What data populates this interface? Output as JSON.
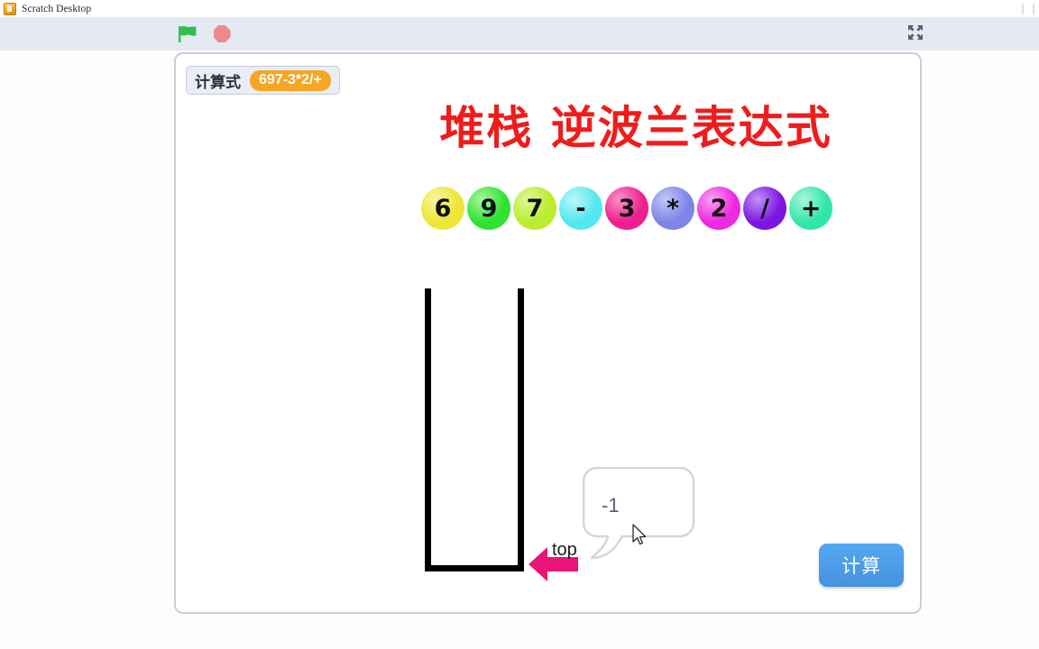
{
  "window": {
    "title": "Scratch Desktop",
    "app_icon": "scratch-app-icon",
    "minimize_icon": "minimize-icon"
  },
  "toolbar": {
    "green_flag_icon": "green-flag-icon",
    "stop_icon": "stop-sign-icon",
    "fullscreen_icon": "exit-fullscreen-icon"
  },
  "stage": {
    "monitor": {
      "label": "计算式",
      "value": "697-3*2/+"
    },
    "title": "堆栈  逆波兰表达式",
    "title_color": "#f01c1c",
    "tokens": [
      {
        "text": "6",
        "color": "#ede637",
        "highlight": "#f7f59e"
      },
      {
        "text": "9",
        "color": "#2fe22f",
        "highlight": "#a9f7a1"
      },
      {
        "text": "7",
        "color": "#b9ed2e",
        "highlight": "#e0f79b"
      },
      {
        "text": "-",
        "color": "#52e8ef",
        "highlight": "#bdf7fa"
      },
      {
        "text": "3",
        "color": "#ee1f8f",
        "highlight": "#fa95c8"
      },
      {
        "text": "*",
        "color": "#7d85e8",
        "highlight": "#c3c7f6"
      },
      {
        "text": "2",
        "color": "#ef29e0",
        "highlight": "#f9a2f2"
      },
      {
        "text": "/",
        "color": "#7b16e0",
        "highlight": "#c193f5"
      },
      {
        "text": "+",
        "color": "#31e7a8",
        "highlight": "#a8f6dc"
      }
    ],
    "stack": {
      "top_label": "top",
      "arrow_color": "#ea1478",
      "border_color": "#000000",
      "contents": []
    },
    "speech_bubble": {
      "text": "-1",
      "border_color": "#d6d6d6",
      "text_color": "#575e75"
    },
    "calc_button": {
      "label": "计算",
      "color": "#4d9de8"
    },
    "cursor": "mouse-pointer"
  }
}
